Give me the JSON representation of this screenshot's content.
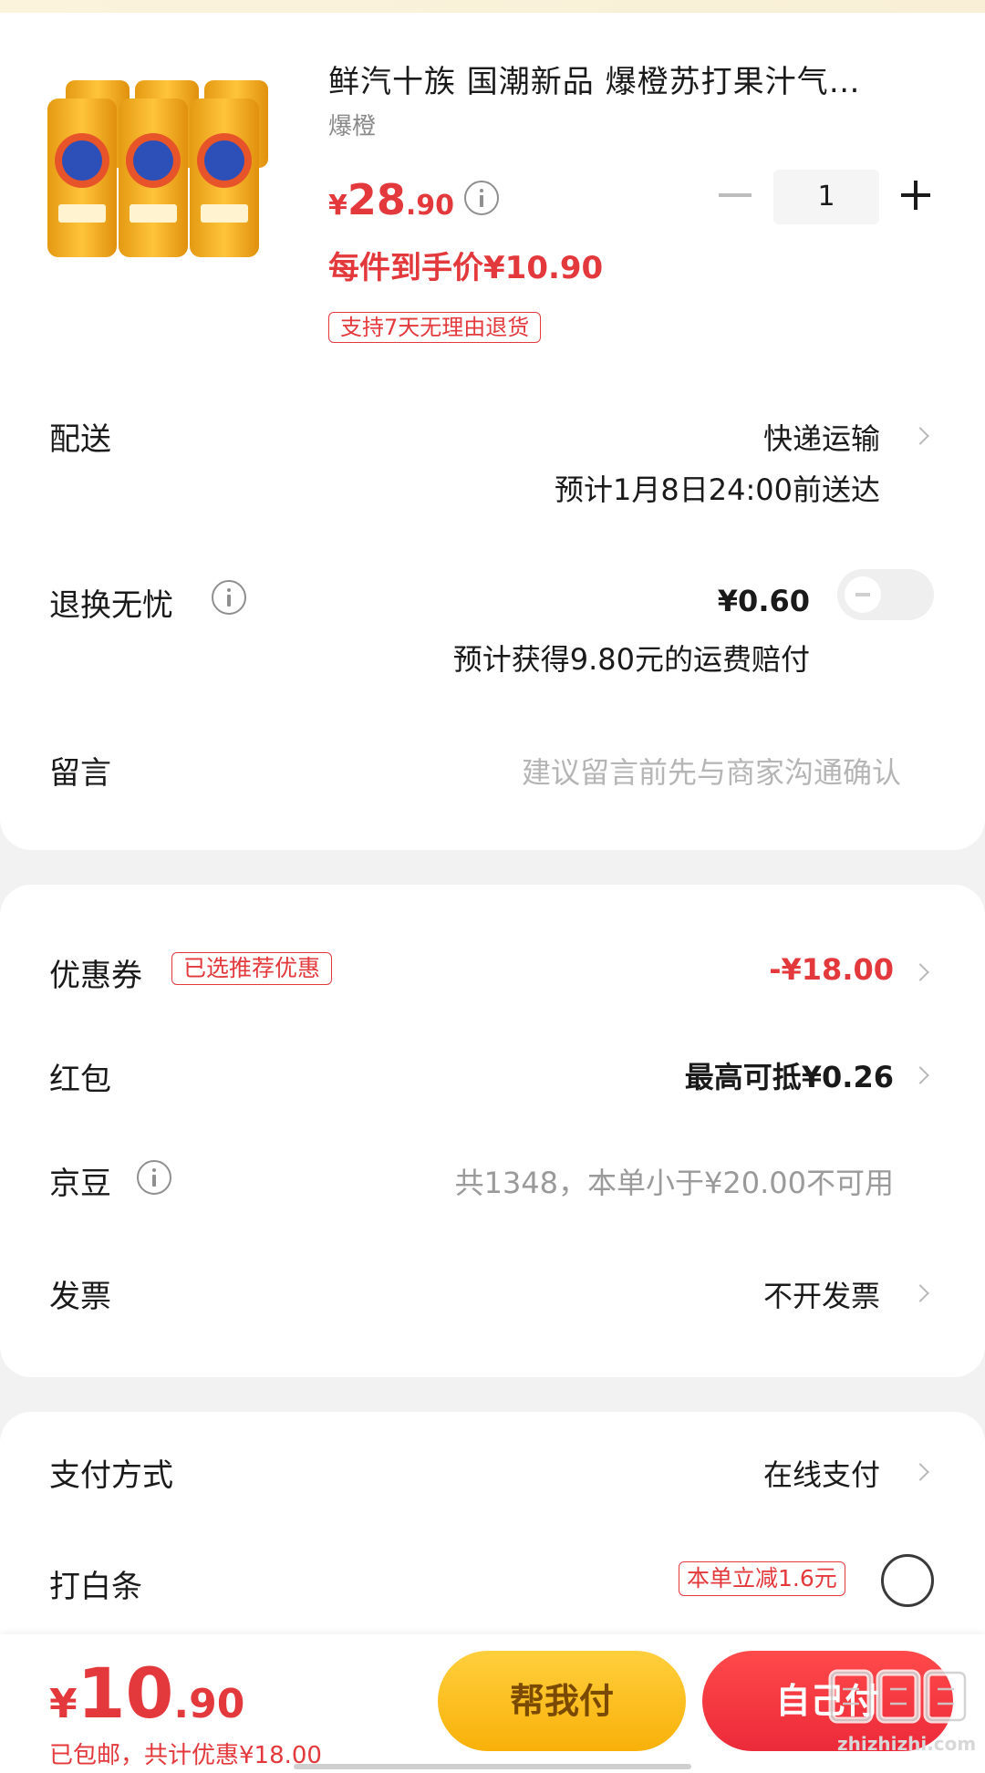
{
  "product": {
    "title": "鲜汽十族 国潮新品 爆橙苏打果汁气…",
    "spec": "爆橙",
    "image_alt": "orange soda cans six-pack",
    "price_currency": "¥",
    "price_int": "28",
    "price_dec": ".90",
    "quantity": "1",
    "unit_price": "每件到手价¥10.90",
    "return_badge": "支持7天无理由退货"
  },
  "delivery": {
    "label": "配送",
    "method": "快递运输",
    "eta": "预计1月8日24:00前送达"
  },
  "return_insurance": {
    "label": "退换无忧",
    "price": "¥0.60",
    "note": "预计获得9.80元的运费赔付",
    "enabled": false
  },
  "message": {
    "label": "留言",
    "placeholder": "建议留言前先与商家沟通确认"
  },
  "discounts": {
    "coupon": {
      "label": "优惠券",
      "badge": "已选推荐优惠",
      "value": "-¥18.00"
    },
    "red_packet": {
      "label": "红包",
      "value": "最高可抵¥0.26"
    },
    "jingdou": {
      "label": "京豆",
      "value": "共1348，本单小于¥20.00不可用"
    },
    "invoice": {
      "label": "发票",
      "value": "不开发票"
    }
  },
  "payment": {
    "method_label": "支付方式",
    "method_value": "在线支付",
    "baitiao_label": "打白条",
    "baitiao_badge": "本单立减1.6元"
  },
  "bottom": {
    "currency": "¥",
    "total_int": "10",
    "total_dec": ".90",
    "summary": "已包邮，共计优惠¥18.00",
    "help_pay": "帮我付",
    "self_pay": "自己付"
  },
  "watermark": {
    "text": "zhizhizhi.com"
  },
  "colors": {
    "accent_red": "#e4393c",
    "help_button": "#ffc21f",
    "self_button": "#f3333f"
  }
}
